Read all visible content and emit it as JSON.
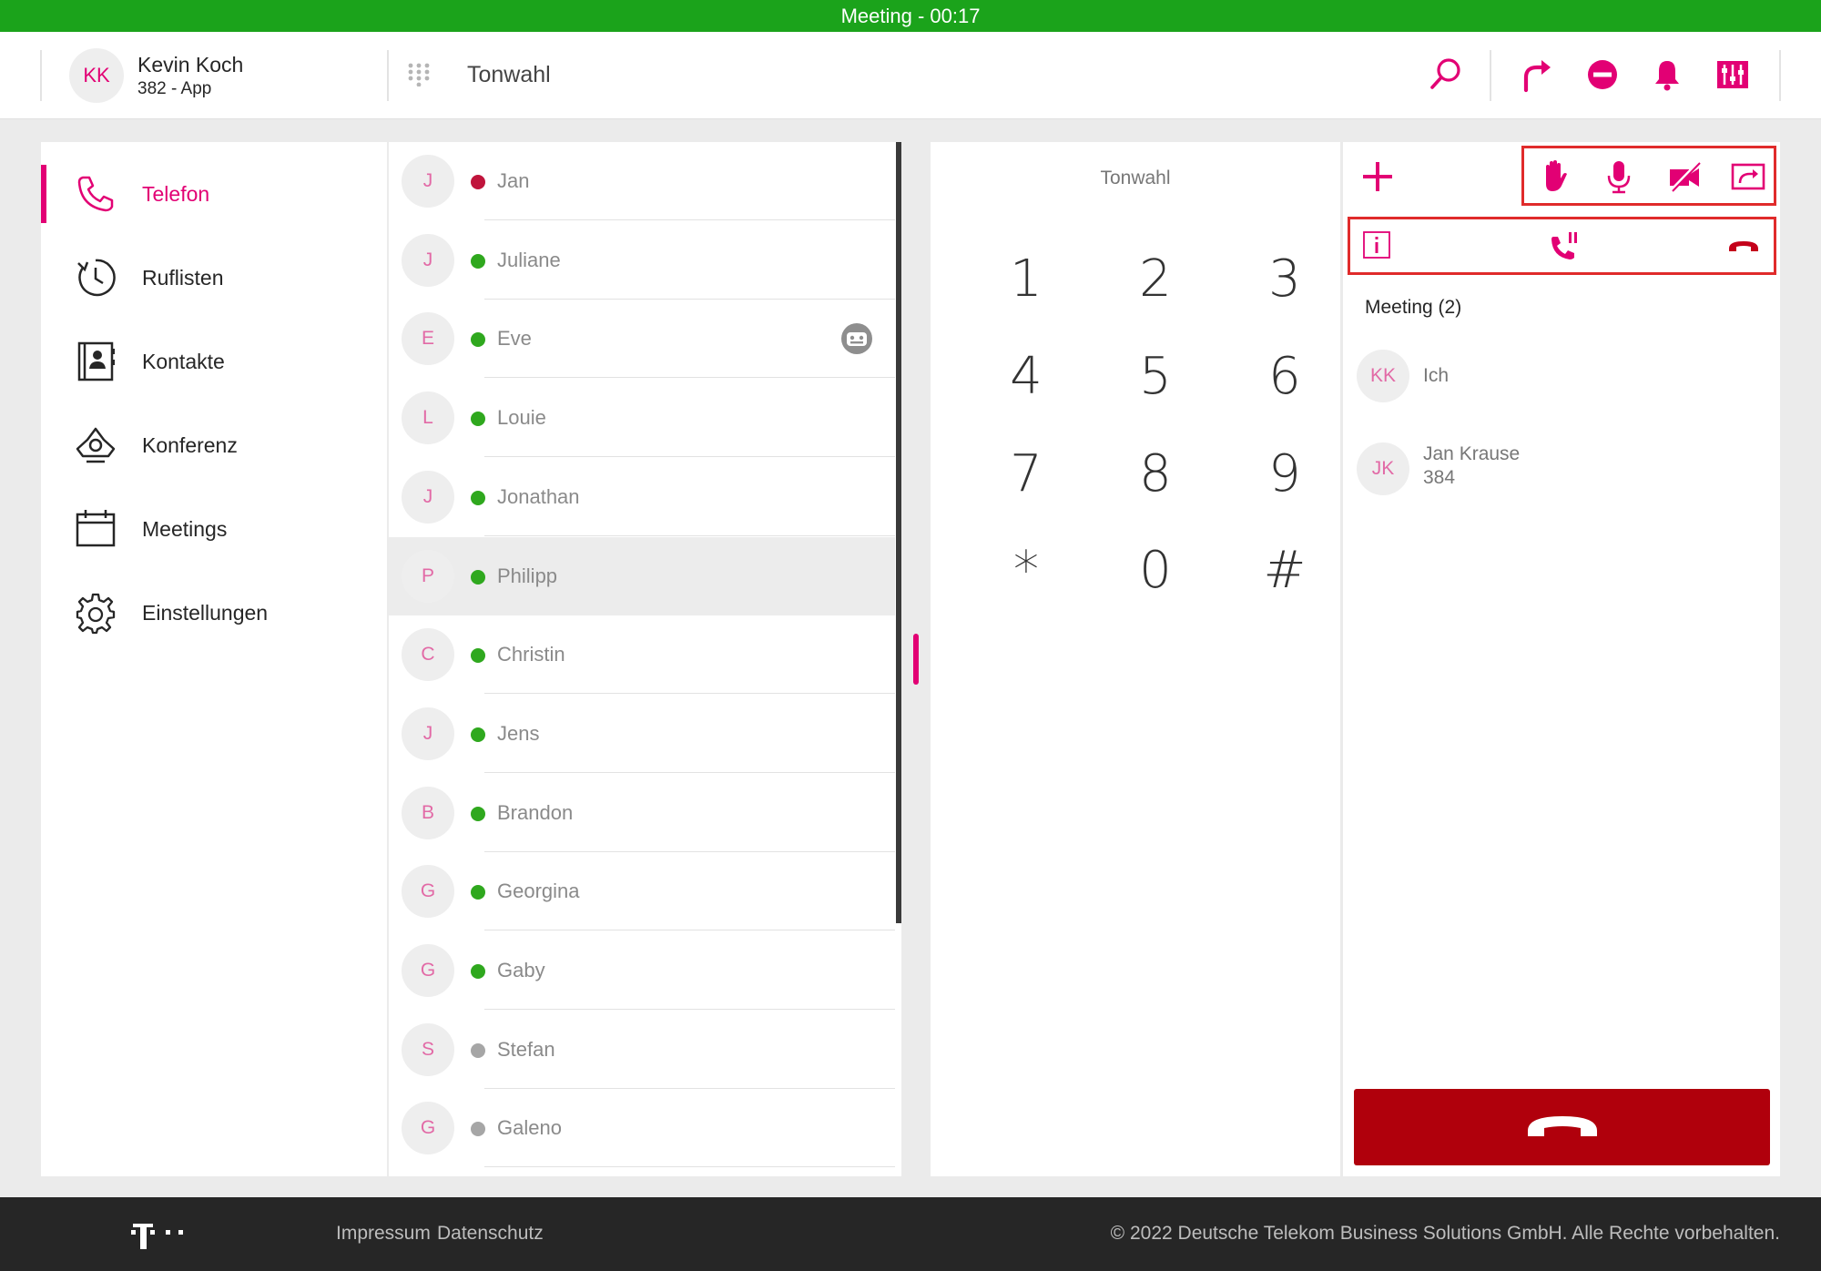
{
  "top_bar": {
    "status": "Meeting - 00:17"
  },
  "user": {
    "initials": "KK",
    "name": "Kevin Koch",
    "extension": "382 - App"
  },
  "header": {
    "dialpad_label": "Tonwahl",
    "icons": [
      "search-icon",
      "forward-icon",
      "do-not-disturb-icon",
      "bell-icon",
      "settings-sliders-icon"
    ]
  },
  "nav": {
    "items": [
      {
        "label": "Telefon",
        "icon": "phone-icon",
        "active": true
      },
      {
        "label": "Ruflisten",
        "icon": "history-icon"
      },
      {
        "label": "Kontakte",
        "icon": "contacts-book-icon"
      },
      {
        "label": "Konferenz",
        "icon": "conference-phone-icon"
      },
      {
        "label": "Meetings",
        "icon": "calendar-icon"
      },
      {
        "label": "Einstellungen",
        "icon": "gear-icon"
      }
    ]
  },
  "contacts": [
    {
      "initial": "J",
      "name": "Jan",
      "status": "busy"
    },
    {
      "initial": "J",
      "name": "Juliane",
      "status": "online"
    },
    {
      "initial": "E",
      "name": "Eve",
      "status": "online",
      "extra_icon": "bot-icon"
    },
    {
      "initial": "L",
      "name": "Louie",
      "status": "online"
    },
    {
      "initial": "J",
      "name": "Jonathan",
      "status": "online"
    },
    {
      "initial": "P",
      "name": "Philipp",
      "status": "online",
      "selected": true
    },
    {
      "initial": "C",
      "name": "Christin",
      "status": "online"
    },
    {
      "initial": "J",
      "name": "Jens",
      "status": "online"
    },
    {
      "initial": "B",
      "name": "Brandon",
      "status": "online"
    },
    {
      "initial": "G",
      "name": "Georgina",
      "status": "online"
    },
    {
      "initial": "G",
      "name": "Gaby",
      "status": "online"
    },
    {
      "initial": "S",
      "name": "Stefan",
      "status": "offline"
    },
    {
      "initial": "G",
      "name": "Galeno",
      "status": "offline"
    }
  ],
  "status_colors": {
    "busy": "#c0143c",
    "online": "#2fa81e",
    "offline": "#a6a6a6"
  },
  "keypad": {
    "title": "Tonwahl",
    "keys": [
      "1",
      "2",
      "3",
      "4",
      "5",
      "6",
      "7",
      "8",
      "9",
      "*",
      "0",
      "#"
    ]
  },
  "call_panel": {
    "toolbar_icons": [
      "raise-hand-icon",
      "microphone-icon",
      "video-off-icon",
      "share-screen-icon"
    ],
    "call_actions": [
      "info-icon",
      "call-in-progress-icon",
      "hangup-icon"
    ],
    "meeting_title": "Meeting (2)",
    "participants": [
      {
        "initials": "KK",
        "name": "Ich",
        "extension": ""
      },
      {
        "initials": "JK",
        "name": "Jan Krause",
        "extension": "384"
      }
    ]
  },
  "footer": {
    "links": [
      "Impressum",
      "Datenschutz"
    ],
    "copyright": "© 2022 Deutsche Telekom Business Solutions GmbH. Alle Rechte vorbehalten."
  },
  "colors": {
    "brand_magenta": "#e20074",
    "topbar_green": "#1ba31b",
    "hangup_red": "#b0000c"
  }
}
